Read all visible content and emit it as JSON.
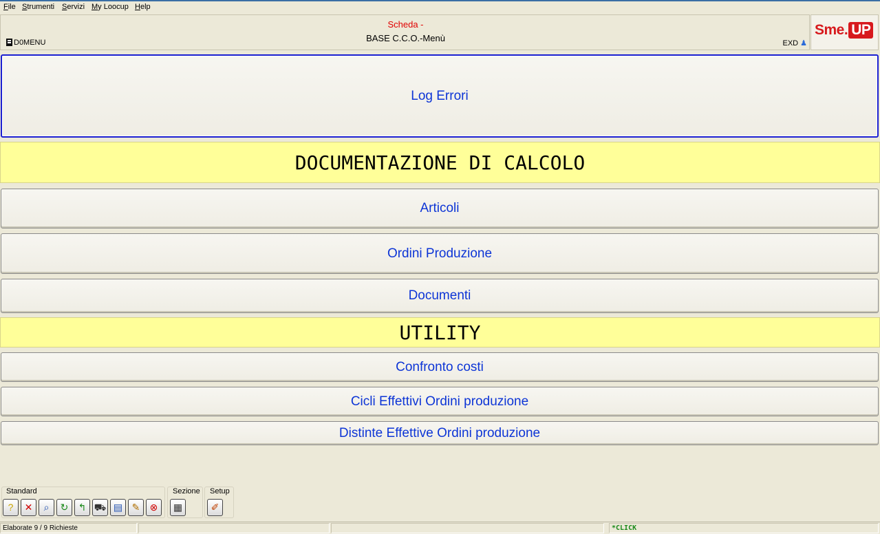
{
  "menu": {
    "items": [
      {
        "underline": "F",
        "rest": "ile"
      },
      {
        "underline": "S",
        "rest": "trumenti"
      },
      {
        "underline": "S",
        "rest": "ervizi"
      },
      {
        "underline": "M",
        "rest": "y Loocup"
      },
      {
        "underline": "H",
        "rest": "elp"
      }
    ]
  },
  "header": {
    "title": "Scheda -",
    "subtitle": "BASE C.C.O.-Menù",
    "left_code": "D0MENU",
    "right_code": "EXD",
    "logo_text": "Sme.",
    "logo_badge": "UP"
  },
  "buttons": {
    "log_errori": "Log Errori",
    "articoli": "Articoli",
    "ordini_produzione": "Ordini Produzione",
    "documenti": "Documenti",
    "confronto_costi": "Confronto costi",
    "cicli_effettivi": "Cicli Effettivi Ordini produzione",
    "distinte_effettive": "Distinte Effettive Ordini produzione"
  },
  "sections": {
    "documentazione": "DOCUMENTAZIONE DI CALCOLO",
    "utility": "UTILITY"
  },
  "toolbar": {
    "standard_label": "Standard",
    "sezione_label": "Sezione",
    "setup_label": "Setup",
    "standard_icons": [
      "help-icon",
      "close-icon",
      "search-icon",
      "refresh-icon",
      "back-icon",
      "cart-icon",
      "export-icon",
      "tools-icon",
      "stop-icon"
    ],
    "sezione_icons": [
      "section-list-icon"
    ],
    "setup_icons": [
      "setup-icon"
    ]
  },
  "status": {
    "requests": "Elaborate 9 / 9 Richieste",
    "click": "*CLICK"
  },
  "colors": {
    "button_text": "#0d35d6",
    "section_bg": "#ffff99",
    "title_red": "#e00000",
    "logo_red": "#d7191d"
  }
}
